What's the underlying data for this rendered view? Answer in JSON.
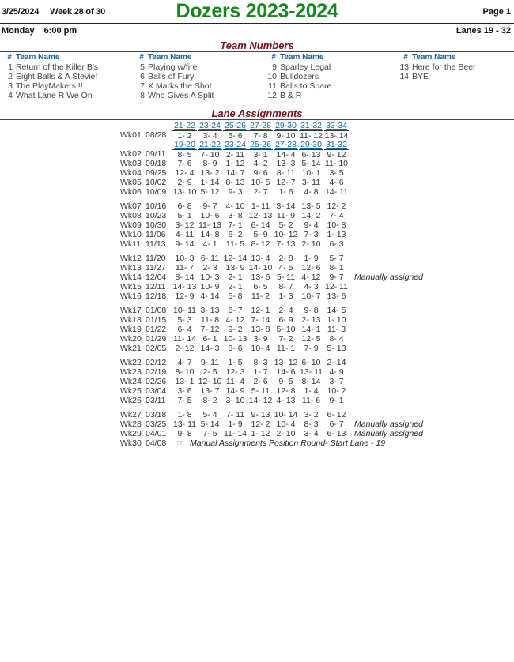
{
  "header": {
    "date": "3/25/2024",
    "week": "Week 28 of 30",
    "title": "Dozers 2023-2024",
    "page": "Page 1",
    "day_time": "Monday",
    "time": "6:00 pm",
    "lanes": "Lanes 19 - 32"
  },
  "team_numbers": {
    "title": "Team Numbers",
    "col_num_header": "#",
    "col_name_header": "Team Name",
    "columns": [
      [
        {
          "num": "1",
          "name": "Return of the Killer B's"
        },
        {
          "num": "2",
          "name": "Eight Balls & A Stevie!"
        },
        {
          "num": "3",
          "name": "The PlayMakers !!"
        },
        {
          "num": "4",
          "name": "What Lane R We On"
        }
      ],
      [
        {
          "num": "5",
          "name": "Playing w/fire"
        },
        {
          "num": "6",
          "name": "Balls of Fury"
        },
        {
          "num": "7",
          "name": "X Marks the Shot"
        },
        {
          "num": "8",
          "name": "Who Gives A Split"
        }
      ],
      [
        {
          "num": "9",
          "name": "Sparley Legal"
        },
        {
          "num": "10",
          "name": "Bulldozers"
        },
        {
          "num": "11",
          "name": "Balls to Spare"
        },
        {
          "num": "12",
          "name": "B & R"
        }
      ],
      [
        {
          "num": "13",
          "name": "Here for the Beer"
        },
        {
          "num": "14",
          "name": "BYE"
        }
      ]
    ]
  },
  "lane_assignments": {
    "title": "Lane Assignments",
    "lanes_week1": [
      "21-22",
      "23-24",
      "25-26",
      "27-28",
      "29-30",
      "31-32",
      "33-34"
    ],
    "lanes_regular": [
      "19-20",
      "21-22",
      "23-24",
      "25-26",
      "27-28",
      "29-30",
      "31-32"
    ],
    "manual_note": "Manually assigned",
    "final_week": {
      "wk": "Wk30",
      "date": "04/08",
      "icon": "pointing-hand-icon",
      "text": "Manual Assignments  Position Round- Start Lane - 19"
    },
    "weeks": [
      {
        "wk": "Wk01",
        "date": "08/28",
        "pairs": [
          "1- 2",
          "3- 4",
          "5- 6",
          "7- 8",
          "9- 10",
          "11- 12",
          "13- 14"
        ],
        "note": ""
      },
      {
        "wk": "Wk02",
        "date": "09/11",
        "pairs": [
          "8- 5",
          "7- 10",
          "2- 11",
          "3- 1",
          "14- 4",
          "6- 13",
          "9- 12"
        ],
        "note": ""
      },
      {
        "wk": "Wk03",
        "date": "09/18",
        "pairs": [
          "7- 6",
          "8- 9",
          "1- 12",
          "4- 2",
          "13- 3",
          "5- 14",
          "11- 10"
        ],
        "note": ""
      },
      {
        "wk": "Wk04",
        "date": "09/25",
        "pairs": [
          "12- 4",
          "13- 2",
          "14- 7",
          "9- 6",
          "8- 11",
          "10- 1",
          "3- 5"
        ],
        "note": ""
      },
      {
        "wk": "Wk05",
        "date": "10/02",
        "pairs": [
          "2- 9",
          "1- 14",
          "8- 13",
          "10- 5",
          "12- 7",
          "3- 11",
          "4- 6"
        ],
        "note": ""
      },
      {
        "wk": "Wk06",
        "date": "10/09",
        "pairs": [
          "13- 10",
          "5- 12",
          "9- 3",
          "2- 7",
          "1- 6",
          "4- 8",
          "14- 11"
        ],
        "note": ""
      },
      {
        "wk": "Wk07",
        "date": "10/16",
        "pairs": [
          "6- 8",
          "9- 7",
          "4- 10",
          "1- 11",
          "3- 14",
          "13- 5",
          "12- 2"
        ],
        "note": ""
      },
      {
        "wk": "Wk08",
        "date": "10/23",
        "pairs": [
          "5- 1",
          "10- 6",
          "3- 8",
          "12- 13",
          "11- 9",
          "14- 2",
          "7- 4"
        ],
        "note": ""
      },
      {
        "wk": "Wk09",
        "date": "10/30",
        "pairs": [
          "3- 12",
          "11- 13",
          "7- 1",
          "6- 14",
          "5- 2",
          "9- 4",
          "10- 8"
        ],
        "note": ""
      },
      {
        "wk": "Wk10",
        "date": "11/06",
        "pairs": [
          "4- 11",
          "14- 8",
          "6- 2",
          "5- 9",
          "10- 12",
          "7- 3",
          "1- 13"
        ],
        "note": ""
      },
      {
        "wk": "Wk11",
        "date": "11/13",
        "pairs": [
          "9- 14",
          "4- 1",
          "11- 5",
          "8- 12",
          "7- 13",
          "2- 10",
          "6- 3"
        ],
        "note": ""
      },
      {
        "wk": "Wk12",
        "date": "11/20",
        "pairs": [
          "10- 3",
          "6- 11",
          "12- 14",
          "13- 4",
          "2- 8",
          "1- 9",
          "5- 7"
        ],
        "note": ""
      },
      {
        "wk": "Wk13",
        "date": "11/27",
        "pairs": [
          "11- 7",
          "2- 3",
          "13- 9",
          "14- 10",
          "4- 5",
          "12- 6",
          "8- 1"
        ],
        "note": ""
      },
      {
        "wk": "Wk14",
        "date": "12/04",
        "pairs": [
          "8- 14",
          "10- 3",
          "2- 1",
          "13- 6",
          "5- 11",
          "4- 12",
          "9- 7"
        ],
        "note": "Manually assigned"
      },
      {
        "wk": "Wk15",
        "date": "12/11",
        "pairs": [
          "14- 13",
          "10- 9",
          "2- 1",
          "6- 5",
          "8- 7",
          "4- 3",
          "12- 11"
        ],
        "note": ""
      },
      {
        "wk": "Wk16",
        "date": "12/18",
        "pairs": [
          "12- 9",
          "4- 14",
          "5- 8",
          "11- 2",
          "1- 3",
          "10- 7",
          "13- 6"
        ],
        "note": ""
      },
      {
        "wk": "Wk17",
        "date": "01/08",
        "pairs": [
          "10- 11",
          "3- 13",
          "6- 7",
          "12- 1",
          "2- 4",
          "9- 8",
          "14- 5"
        ],
        "note": ""
      },
      {
        "wk": "Wk18",
        "date": "01/15",
        "pairs": [
          "5- 3",
          "11- 8",
          "4- 12",
          "7- 14",
          "6- 9",
          "2- 13",
          "1- 10"
        ],
        "note": ""
      },
      {
        "wk": "Wk19",
        "date": "01/22",
        "pairs": [
          "6- 4",
          "7- 12",
          "9- 2",
          "13- 8",
          "5- 10",
          "14- 1",
          "11- 3"
        ],
        "note": ""
      },
      {
        "wk": "Wk20",
        "date": "01/29",
        "pairs": [
          "11- 14",
          "6- 1",
          "10- 13",
          "3- 9",
          "7- 2",
          "12- 5",
          "8- 4"
        ],
        "note": ""
      },
      {
        "wk": "Wk21",
        "date": "02/05",
        "pairs": [
          "2- 12",
          "14- 3",
          "8- 6",
          "10- 4",
          "11- 1",
          "7- 9",
          "5- 13"
        ],
        "note": ""
      },
      {
        "wk": "Wk22",
        "date": "02/12",
        "pairs": [
          "4- 7",
          "9- 11",
          "1- 5",
          "8- 3",
          "13- 12",
          "6- 10",
          "2- 14"
        ],
        "note": ""
      },
      {
        "wk": "Wk23",
        "date": "02/19",
        "pairs": [
          "8- 10",
          "2- 5",
          "12- 3",
          "1- 7",
          "14- 6",
          "13- 11",
          "4- 9"
        ],
        "note": ""
      },
      {
        "wk": "Wk24",
        "date": "02/26",
        "pairs": [
          "13- 1",
          "12- 10",
          "11- 4",
          "2- 6",
          "9- 5",
          "8- 14",
          "3- 7"
        ],
        "note": ""
      },
      {
        "wk": "Wk25",
        "date": "03/04",
        "pairs": [
          "3- 6",
          "13- 7",
          "14- 9",
          "5- 11",
          "12- 8",
          "1- 4",
          "10- 2"
        ],
        "note": ""
      },
      {
        "wk": "Wk26",
        "date": "03/11",
        "pairs": [
          "7- 5",
          "8- 2",
          "3- 10",
          "14- 12",
          "4- 13",
          "11- 6",
          "9- 1"
        ],
        "note": ""
      },
      {
        "wk": "Wk27",
        "date": "03/18",
        "pairs": [
          "1- 8",
          "5- 4",
          "7- 11",
          "9- 13",
          "10- 14",
          "3- 2",
          "6- 12"
        ],
        "note": ""
      },
      {
        "wk": "Wk28",
        "date": "03/25",
        "pairs": [
          "13- 11",
          "5- 14",
          "1- 9",
          "12- 2",
          "10- 4",
          "8- 3",
          "6- 7"
        ],
        "note": "Manually assigned"
      },
      {
        "wk": "Wk29",
        "date": "04/01",
        "pairs": [
          "9- 8",
          "7- 5",
          "11- 14",
          "1- 12",
          "2- 10",
          "3- 4",
          "6- 13"
        ],
        "note": "Manually assigned"
      }
    ]
  }
}
